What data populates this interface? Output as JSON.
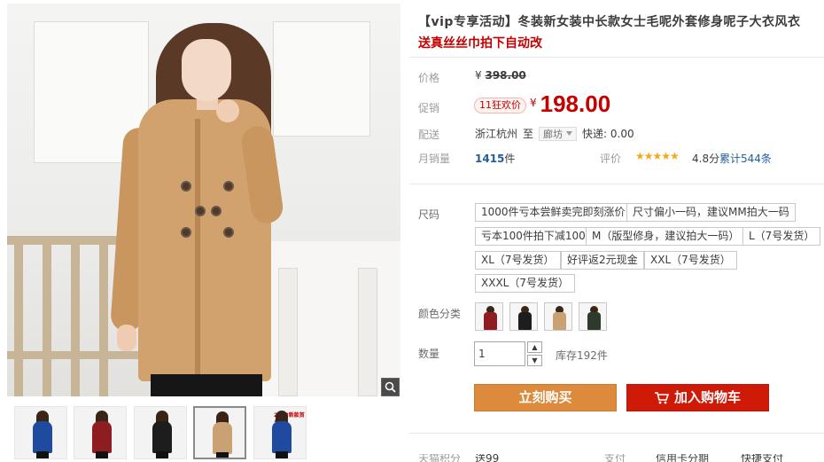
{
  "product": {
    "title": "【vip专享活动】冬装新女装中长款女士毛呢外套修身呢子大衣风衣",
    "subtitle": "送真丝丝巾拍下自动改"
  },
  "price": {
    "label": "价格",
    "currency": "¥",
    "original": "398.00"
  },
  "promo": {
    "label": "促销",
    "badge": "11狂欢价",
    "currency": "¥",
    "price": "198.00"
  },
  "shipping": {
    "label": "配送",
    "origin": "浙江杭州",
    "to": "至",
    "destination": "廊坊",
    "fee": "快递: 0.00"
  },
  "sales": {
    "label": "月销量",
    "count": "1415",
    "unit": "件"
  },
  "rating": {
    "label": "评价",
    "stars": "★★★★★",
    "score": "4.8分",
    "reviews": "累计544条"
  },
  "sizes": {
    "label": "尺码",
    "options": [
      "1000件亏本尝鲜卖完即刻涨价",
      "尺寸偏小一码，建议MM拍大一码",
      "亏本100件拍下减100",
      "M（版型修身，建议拍大一码）",
      "L（7号发货）",
      "XL（7号发货）",
      "好评返2元现金",
      "XXL（7号发货）",
      "XXXL（7号发货）"
    ]
  },
  "colors": {
    "label": "颜色分类",
    "swatches": [
      {
        "name": "酒红色",
        "color": "#8e1d22"
      },
      {
        "name": "黑色",
        "color": "#1d1d1d"
      },
      {
        "name": "驼色",
        "color": "#caa172"
      },
      {
        "name": "墨绿色",
        "color": "#2e3a2c"
      }
    ]
  },
  "quantity": {
    "label": "数量",
    "value": "1",
    "up": "▲",
    "down": "▼",
    "stock": "库存192件"
  },
  "actions": {
    "buy_now": "立刻购买",
    "add_to_cart": "加入购物车"
  },
  "footer": {
    "items": [
      "天猫积分",
      "送99",
      "支付",
      "信用卡分期",
      "快捷支付"
    ]
  },
  "gallery": {
    "thumbs": [
      {
        "coat": "#1e4aa0",
        "active": false
      },
      {
        "coat": "#8e1d22",
        "active": false
      },
      {
        "coat": "#1d1d1d",
        "active": false
      },
      {
        "coat": "#caa172",
        "active": true
      },
      {
        "coat": "#1e4aa0",
        "active": false,
        "tag": "2013新款首发"
      }
    ]
  },
  "colors_theme": {
    "accent_red": "#c40000",
    "buy_orange": "#dd8a3c",
    "cart_red": "#cf1a08",
    "link_blue": "#1f5d9e",
    "star_gold": "#f3a81d"
  }
}
